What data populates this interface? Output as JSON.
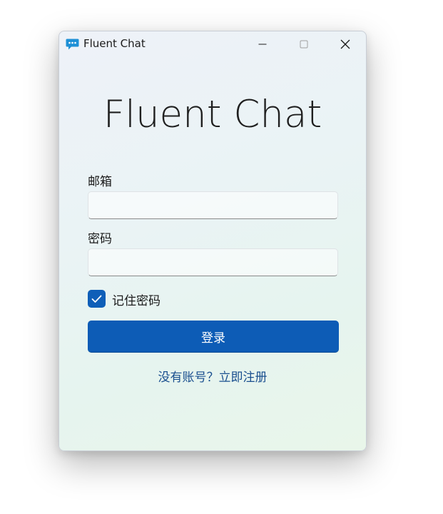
{
  "window": {
    "title": "Fluent Chat",
    "icon": "chat-bubble-icon",
    "controls": {
      "minimize": "minimize-icon",
      "maximize": "maximize-icon",
      "close": "close-icon"
    }
  },
  "login": {
    "heading": "Fluent Chat",
    "email_label": "邮箱",
    "email_value": "",
    "email_placeholder": "",
    "password_label": "密码",
    "password_value": "",
    "password_placeholder": "",
    "remember_label": "记住密码",
    "remember_checked": true,
    "submit_label": "登录",
    "register_link": "没有账号？立即注册"
  },
  "colors": {
    "accent": "#0d5cb6",
    "link": "#1a4f8f",
    "icon_blue": "#1e90d6"
  }
}
